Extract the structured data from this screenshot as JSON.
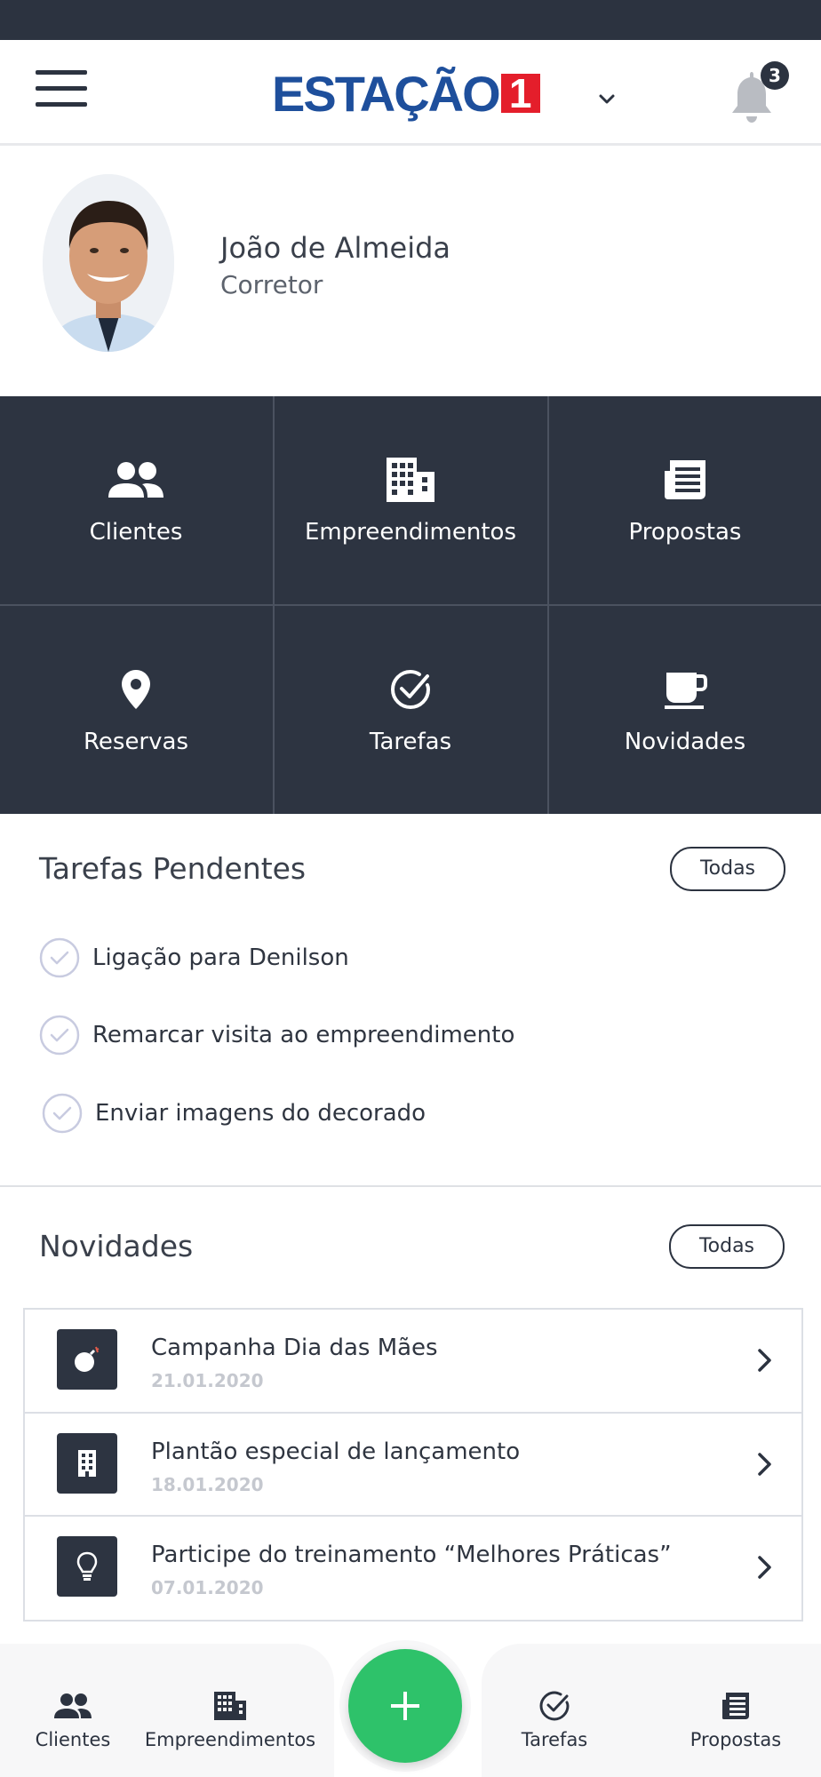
{
  "header": {
    "logo_text": "ESTAÇÃO",
    "logo_number": "1",
    "notification_count": "3"
  },
  "profile": {
    "name": "João de Almeida",
    "role": "Corretor"
  },
  "menu_grid": [
    {
      "label": "Clientes",
      "icon": "people-icon"
    },
    {
      "label": "Empreendimentos",
      "icon": "building-icon"
    },
    {
      "label": "Propostas",
      "icon": "document-icon"
    },
    {
      "label": "Reservas",
      "icon": "location-pin-icon"
    },
    {
      "label": "Tarefas",
      "icon": "check-circle-icon"
    },
    {
      "label": "Novidades",
      "icon": "coffee-cup-icon"
    }
  ],
  "tasks": {
    "title": "Tarefas Pendentes",
    "all_label": "Todas",
    "items": [
      "Ligação para Denilson",
      "Remarcar visita ao empreendimento",
      "Enviar imagens do decorado"
    ]
  },
  "news": {
    "title": "Novidades",
    "all_label": "Todas",
    "items": [
      {
        "title": "Campanha Dia das Mães",
        "date": "21.01.2020",
        "icon": "bomb-icon"
      },
      {
        "title": "Plantão especial de lançamento",
        "date": "18.01.2020",
        "icon": "building-icon"
      },
      {
        "title": "Participe do treinamento “Melhores Práticas”",
        "date": "07.01.2020",
        "icon": "lightbulb-icon"
      }
    ]
  },
  "bottom_nav": [
    {
      "label": "Clientes",
      "icon": "people-icon"
    },
    {
      "label": "Empreendimentos",
      "icon": "building-icon"
    },
    {
      "label": "Tarefas",
      "icon": "check-circle-icon"
    },
    {
      "label": "Propostas",
      "icon": "document-icon"
    }
  ],
  "fab": {
    "icon": "plus-icon"
  },
  "colors": {
    "dark": "#2c3340",
    "brand_blue": "#1e4f9c",
    "brand_red": "#e41e2b",
    "fab_green": "#2ec26a"
  }
}
